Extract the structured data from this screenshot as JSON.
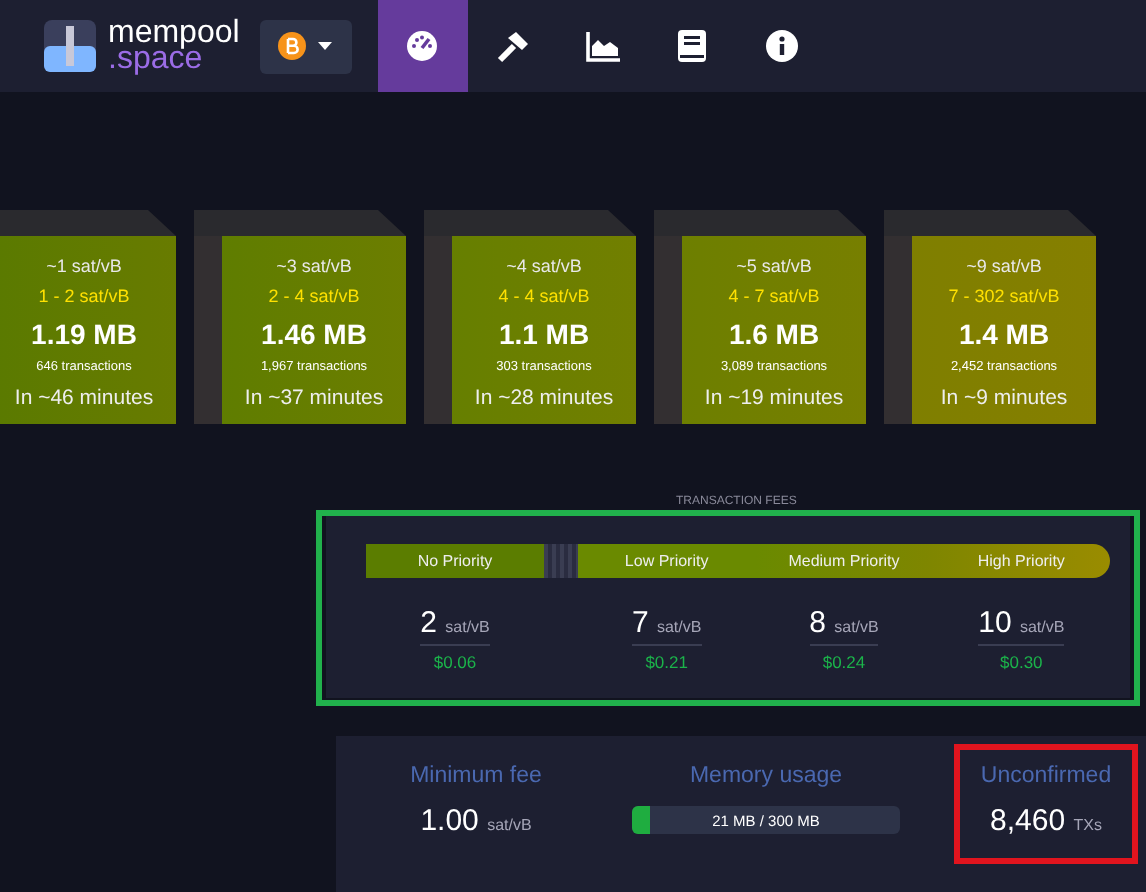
{
  "header": {
    "logo_title": "mempool",
    "logo_subtitle": ".space",
    "network_menu": {
      "kind": "bitcoin"
    },
    "nav": [
      {
        "kind": "dashboard",
        "selected": true
      },
      {
        "kind": "hammer",
        "selected": false
      },
      {
        "kind": "chart",
        "selected": false
      },
      {
        "kind": "book",
        "selected": false
      },
      {
        "kind": "info",
        "selected": false
      }
    ]
  },
  "blocks": [
    {
      "fee_median": "~1 sat/vB",
      "fee_range": "1 - 2 sat/vB",
      "size": "1.19 MB",
      "transactions": "646 transactions",
      "eta": "In ~46 minutes",
      "color": "#5a7a00"
    },
    {
      "fee_median": "~3 sat/vB",
      "fee_range": "2 - 4 sat/vB",
      "size": "1.46 MB",
      "transactions": "1,967 transactions",
      "eta": "In ~37 minutes",
      "color": "#5f7d00"
    },
    {
      "fee_median": "~4 sat/vB",
      "fee_range": "4 - 4 sat/vB",
      "size": "1.1 MB",
      "transactions": "303 transactions",
      "eta": "In ~28 minutes",
      "color": "#667f00"
    },
    {
      "fee_median": "~5 sat/vB",
      "fee_range": "4 - 7 sat/vB",
      "size": "1.6 MB",
      "transactions": "3,089 transactions",
      "eta": "In ~19 minutes",
      "color": "#6d7f00"
    },
    {
      "fee_median": "~9 sat/vB",
      "fee_range": "7 - 302 sat/vB",
      "size": "1.4 MB",
      "transactions": "2,452 transactions",
      "eta": "In ~9 minutes",
      "color": "#7f7f00"
    }
  ],
  "fees": {
    "title": "TRANSACTION FEES",
    "highlighted": true,
    "priorities": [
      {
        "label": "No Priority",
        "rate": "2",
        "unit": "sat/vB",
        "usd": "$0.06"
      },
      {
        "label": "Low Priority",
        "rate": "7",
        "unit": "sat/vB",
        "usd": "$0.21"
      },
      {
        "label": "Medium Priority",
        "rate": "8",
        "unit": "sat/vB",
        "usd": "$0.24"
      },
      {
        "label": "High Priority",
        "rate": "10",
        "unit": "sat/vB",
        "usd": "$0.30"
      }
    ]
  },
  "stats": [
    {
      "kind": "value",
      "label": "Minimum fee",
      "value": "1.00",
      "unit": "sat/vB",
      "highlighted": false
    },
    {
      "kind": "bar",
      "label": "Memory usage",
      "value": "21 MB / 300 MB",
      "level": 0.07,
      "highlighted": false
    },
    {
      "kind": "value",
      "label": "Unconfirmed",
      "value": "8,460",
      "unit": "TXs",
      "highlighted": true
    }
  ]
}
